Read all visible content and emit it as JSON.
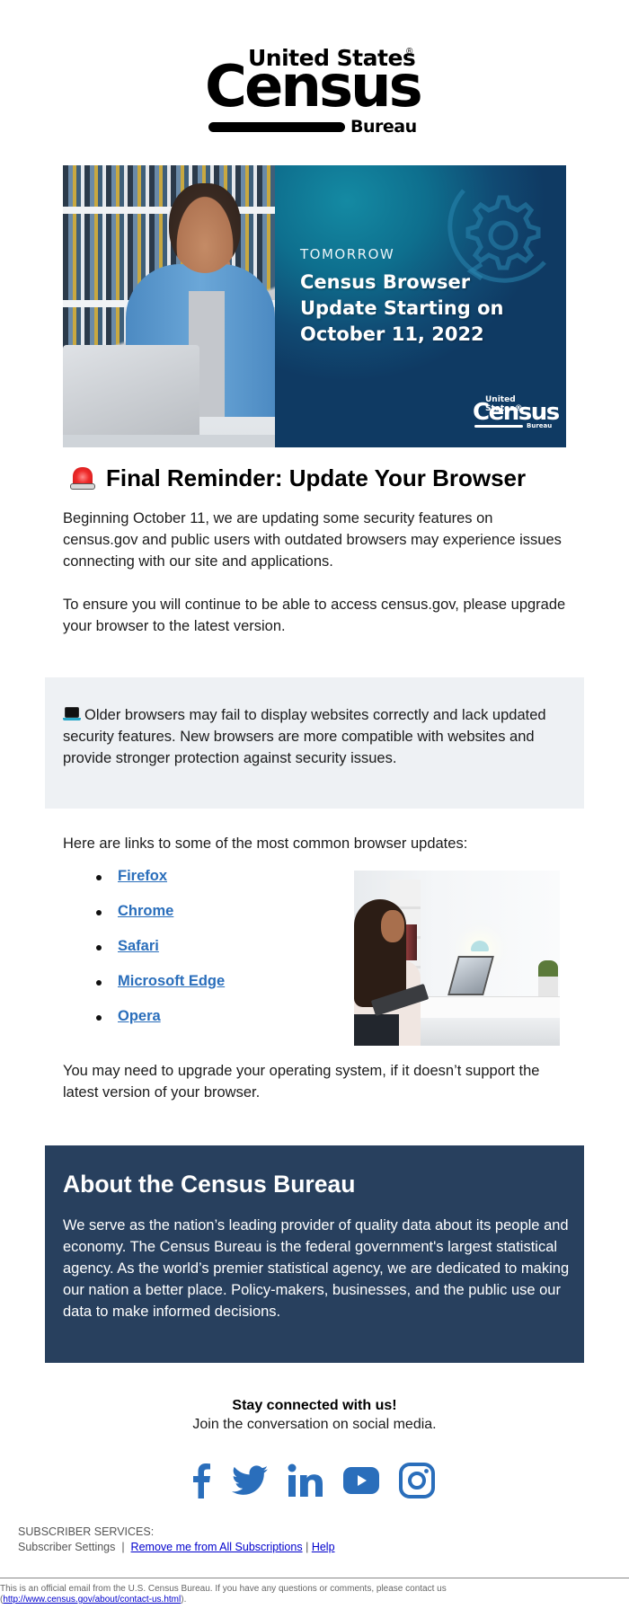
{
  "logo": {
    "line1": "United States",
    "registered": "®",
    "line2": "Census",
    "line3": "Bureau"
  },
  "hero": {
    "kicker": "TOMORROW",
    "title": "Census Browser Update Starting on October 11, 2022",
    "mini_logo": {
      "line1": "United States®",
      "line2": "Census",
      "line3": "Bureau"
    }
  },
  "headline": {
    "icon": "police-car-light-icon",
    "text": "Final Reminder: Update Your Browser"
  },
  "intro": {
    "paragraph1": "Beginning October 11, we are updating some security features on census.gov and public users with outdated browsers may experience issues connecting with our site and applications.",
    "paragraph2": "To ensure you will continue to be able to access census.gov, please upgrade your browser to the latest version."
  },
  "callout": {
    "icon": "laptop-icon",
    "text": "Older browsers may fail to display websites correctly and lack updated security features. New browsers are more compatible with websites and provide stronger protection against security issues."
  },
  "browsers": {
    "intro": "Here are links to some of the most common browser updates:",
    "items": [
      {
        "label": "Firefox"
      },
      {
        "label": "Chrome"
      },
      {
        "label": "Safari"
      },
      {
        "label": "Microsoft Edge"
      },
      {
        "label": "Opera"
      }
    ],
    "note": "You may need to upgrade your operating system, if it doesn’t support the latest version of your browser."
  },
  "about": {
    "title": "About the Census Bureau",
    "text": "We serve as the nation’s leading provider of quality data about its people and economy. The Census Bureau is the federal government's largest statistical agency. As the world’s premier statistical agency, we are dedicated to making our nation a better place. Policy-makers, businesses, and the public use our data to make informed decisions."
  },
  "social": {
    "heading": "Stay connected with us!",
    "subheading": "Join the conversation on social media.",
    "icons": [
      "facebook-icon",
      "twitter-icon",
      "linkedin-icon",
      "youtube-icon",
      "instagram-icon"
    ],
    "color": "#2a6ebb"
  },
  "subscriber": {
    "label": "SUBSCRIBER SERVICES:",
    "settings": "Subscriber Settings",
    "separator": "|",
    "remove": "Remove me from All Subscriptions",
    "help": "Help"
  },
  "footer": {
    "text": "This is an official email from the U.S. Census Bureau. If you have any questions or comments, please contact us",
    "link": "http://www.census.gov/about/contact-us.html",
    "open": "(",
    "close": ")."
  },
  "colors": {
    "link": "#2a6ebb",
    "about_bg": "#28405e",
    "callout_bg": "#eef1f4"
  }
}
